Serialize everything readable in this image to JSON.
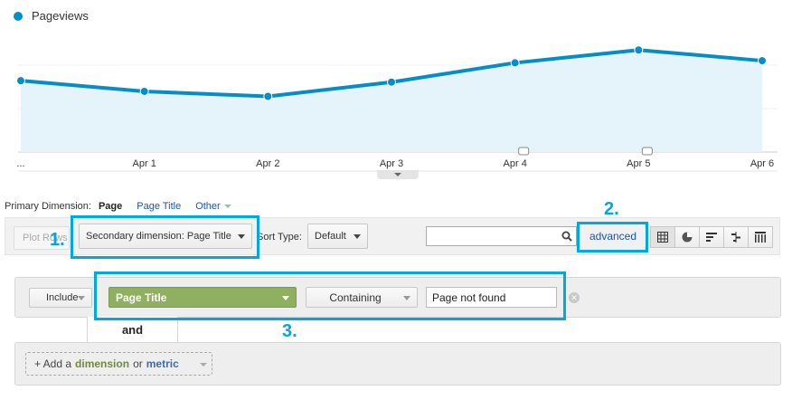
{
  "chart_data": {
    "type": "area",
    "series": [
      {
        "name": "Pageviews",
        "values": [
          100,
          85,
          78,
          98,
          125,
          143,
          128
        ]
      }
    ],
    "x_tick_labels": [
      "...",
      "Apr 1",
      "Apr 2",
      "Apr 3",
      "Apr 4",
      "Apr 5",
      "Apr 6"
    ],
    "annotation_markers": [
      "Apr 4",
      "Apr 5"
    ],
    "grid": true,
    "color": "#058dc7",
    "fill": "#e5f3fa"
  },
  "legend": {
    "label": "Pageviews",
    "color": "#058dc7"
  },
  "primary_dimension": {
    "label": "Primary Dimension:",
    "options": [
      "Page",
      "Page Title",
      "Other"
    ]
  },
  "toolbar": {
    "plot_rows": "Plot Rows",
    "secondary_dimension": "Secondary dimension: Page Title",
    "sort_label": "Sort Type:",
    "sort_value": "Default",
    "search_value": "",
    "advanced": "advanced",
    "view_icons": [
      "table-view-icon",
      "pie-view-icon",
      "performance-view-icon",
      "comparison-view-icon",
      "pivot-view-icon"
    ]
  },
  "filter": {
    "include": "Include",
    "dimension": "Page Title",
    "match_type": "Containing",
    "value": "Page not found",
    "and_label": "and"
  },
  "add_condition": {
    "prefix": "+ Add a",
    "dimension": "dimension",
    "or": "or",
    "metric": "metric"
  },
  "annotations": {
    "one": "1.",
    "two": "2.",
    "three": "3.",
    "color": "#00a8e1"
  }
}
